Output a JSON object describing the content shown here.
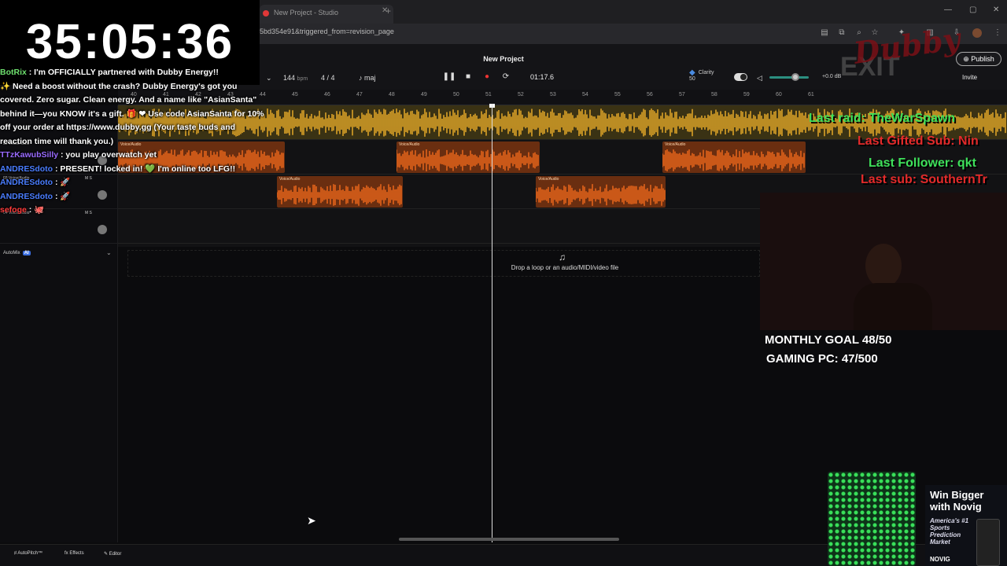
{
  "browser": {
    "tab_title": "New Project - Studio",
    "url": "5bd354e91&triggered_from=revision_page"
  },
  "daw": {
    "project_title": "New Project",
    "bpm": "144",
    "bpm_unit": "bpm",
    "time_signature": "4 / 4",
    "key": "maj",
    "time": "01:17.6",
    "clarity_label": "Clarity",
    "clarity_value": "50",
    "volume_db": "+0.0 dB",
    "publish_label": "Publish",
    "invite_label": "Invite",
    "ruler": [
      "40",
      "41",
      "42",
      "43",
      "44",
      "45",
      "46",
      "47",
      "48",
      "49",
      "50",
      "51",
      "52",
      "53",
      "54",
      "55",
      "56",
      "57",
      "58",
      "59",
      "60",
      "61"
    ],
    "tracks": [
      {
        "name": "02 Voice/Audio",
        "ms": "M S"
      },
      {
        "name": "03 Voice/Audio",
        "ms": "M S"
      },
      {
        "name": "04 Voice/Audio",
        "ms": "M S"
      }
    ],
    "clip_label": "Voice/Audio",
    "drop_text": "Drop a loop or an audio/MIDI/video file",
    "automix_label": "AutoMix",
    "automix_badge": "AI",
    "bottom": {
      "autopitch": "AutoPitch™",
      "effects": "Effects",
      "editor": "Editor"
    },
    "colors": {
      "master_wave": "#f2b22a",
      "clip_wave": "#f36b1c",
      "accent": "#3b6ee0"
    }
  },
  "stream": {
    "clock": "35:05:36",
    "chat": [
      {
        "user": "BotRix",
        "text": ": I'm OFFICIALLY partnered with Dubby Energy!!",
        "color": "#6ee06e"
      },
      {
        "user": "",
        "text": "✨ Need a boost without the crash? Dubby Energy's got you covered. Zero sugar. Clean energy. And a name like \"AsianSanta\" behind it—you KNOW it's a gift. 🎁 ❤ Use code AsianSanta for 10% off your order at https://www.dubby.gg (Your taste buds and reaction time will thank you.)",
        "color": "#ffffff"
      },
      {
        "user": "TTzKawubSilly",
        "text": ": you play overwatch yet",
        "color": "#9a6bff"
      },
      {
        "user": "ANDRESdoto",
        "text": ": PRESENT! locked in! 💚 I'm online too LFG!!",
        "color": "#4a7dff"
      },
      {
        "user": "ANDRESdoto",
        "text": ": 🚀",
        "color": "#4a7dff"
      },
      {
        "user": "ANDRESdoto",
        "text": ": 🚀",
        "color": "#4a7dff"
      },
      {
        "user": "sefoge",
        "text": ": 🐙",
        "color": "#ff3b3b"
      }
    ],
    "last_raid": "Last raid: TheWarSpawn",
    "last_gifted": "Last Gifted Sub: Nin",
    "last_follower": "Last Follower: qkt",
    "last_sub": "Last sub: SouthernTr",
    "goal_monthly": "MONTHLY GOAL 48/50",
    "goal_pc": "GAMING PC: 47/500",
    "logo_text": "Dubby",
    "exit_text": "EXIT",
    "ad": {
      "title": "Win Bigger with Novig",
      "subtitle": "America's #1 Sports Prediction Market",
      "brand": "NOVIG"
    }
  }
}
